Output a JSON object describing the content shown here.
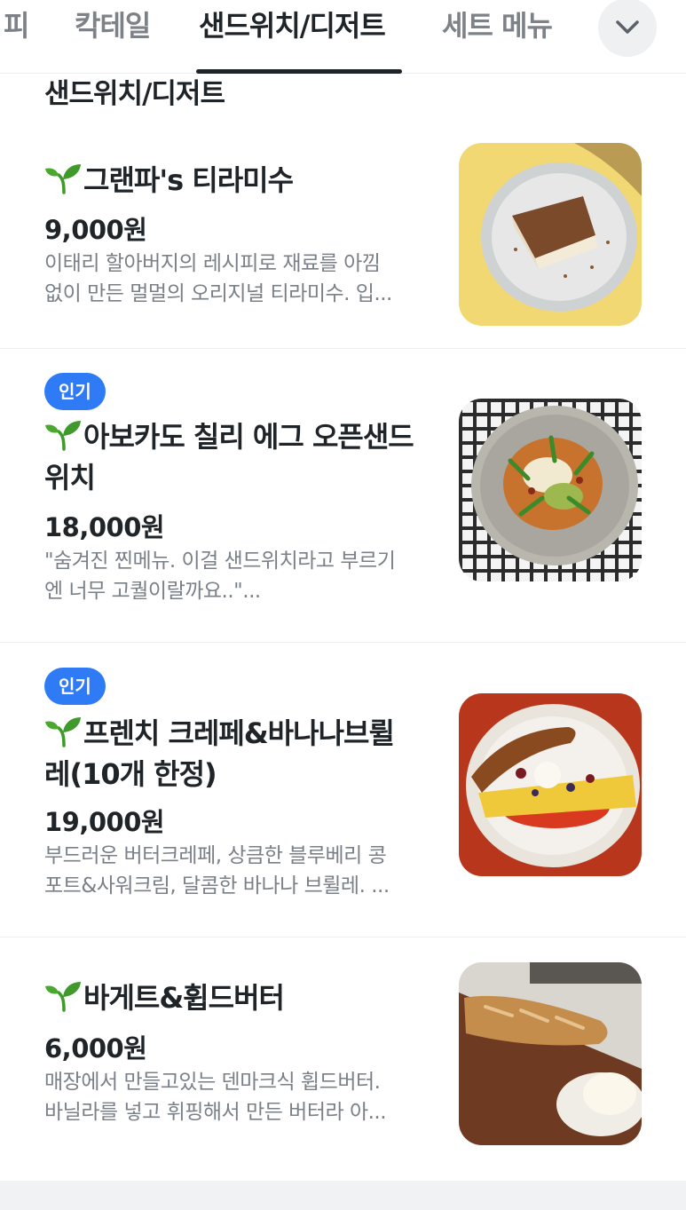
{
  "tabs": [
    {
      "label": "피"
    },
    {
      "label": "칵테일"
    },
    {
      "label": "샌드위치/디저트"
    },
    {
      "label": "세트 메뉴"
    }
  ],
  "active_tab_index": 2,
  "section_title": "샌드위치/디저트",
  "menu": [
    {
      "badge": "",
      "name_line1": "그랜파's 티라미수",
      "name_line2": "",
      "price": "9,000원",
      "desc_line1": "이태리 할아버지의 레시피로 재료를 아낌",
      "desc_line2": "없이 만든 멀멀의 오리지널 티라미수. 입...",
      "image": "tiramisu-photo"
    },
    {
      "badge": "인기",
      "name_line1": "아보카도 칠리 에그 오픈샌드",
      "name_line2": "위치",
      "price": "18,000원",
      "desc_line1": "\"숨겨진 찐메뉴. 이걸 샌드위치라고 부르기",
      "desc_line2": "엔 너무 고퀄이랄까요..\"...",
      "image": "avocado-sandwich-photo"
    },
    {
      "badge": "인기",
      "name_line1": "프렌치 크레페&바나나브륄",
      "name_line2": "레(10개 한정)",
      "price": "19,000원",
      "desc_line1": "부드러운 버터크레페, 상큼한 블루베리 콩",
      "desc_line2": "포트&사워크림, 달콤한 바나나 브륄레. ...",
      "image": "crepe-banana-photo"
    },
    {
      "badge": "",
      "name_line1": "바게트&휩드버터",
      "name_line2": "",
      "price": "6,000원",
      "desc_line1": "매장에서 만들고있는 덴마크식 휩드버터.",
      "desc_line2": "바닐라를 넣고 휘핑해서 만든 버터라 아...",
      "image": "baguette-butter-photo"
    }
  ],
  "icons": {
    "more": "chevron-down-icon",
    "menu_prefix": "sprout-icon"
  },
  "colors": {
    "badge": "#2f7bf6",
    "text": "#1f2429",
    "muted": "#7a8088",
    "sprout": "#3f9a2b"
  }
}
